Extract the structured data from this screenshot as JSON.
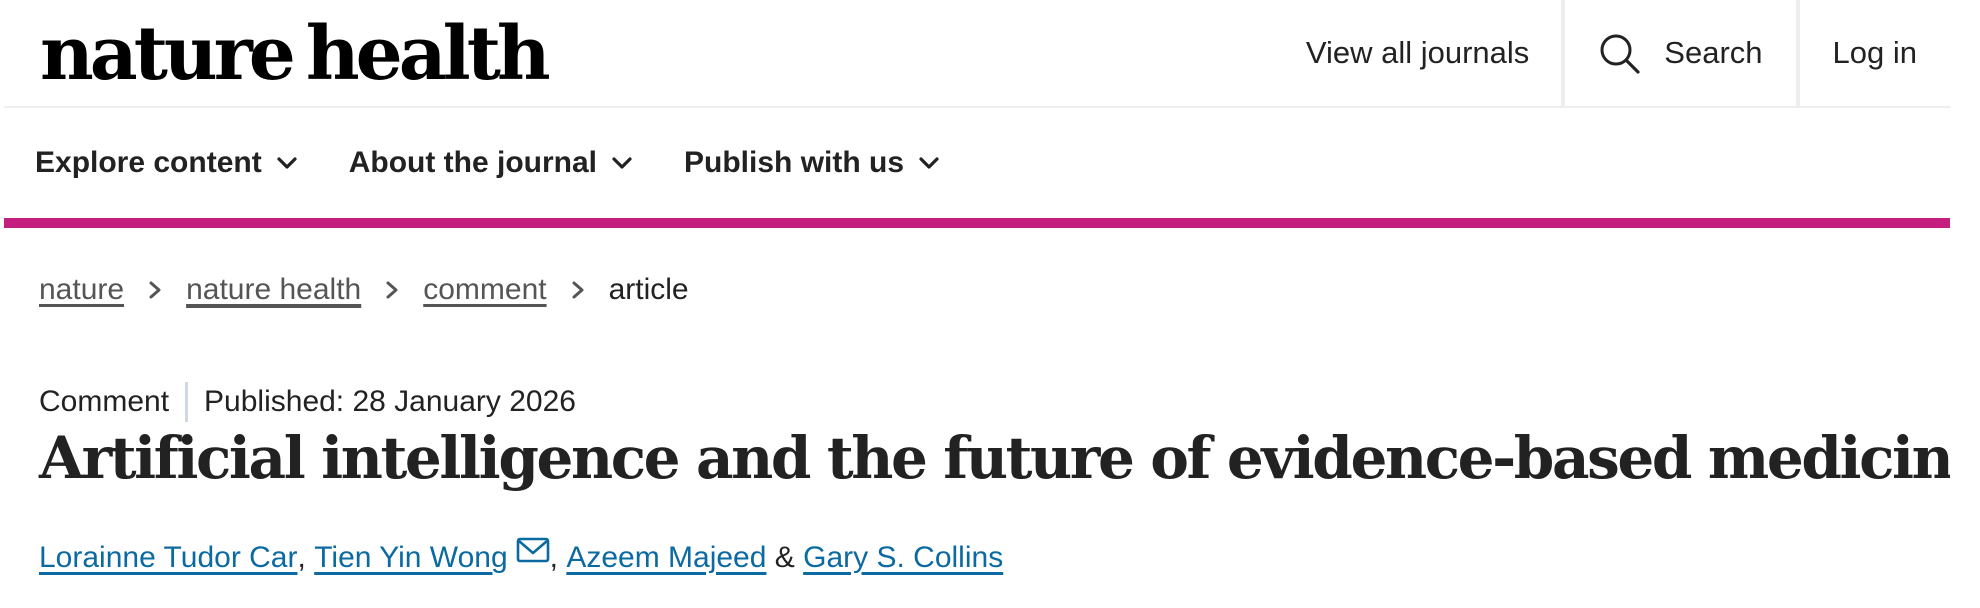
{
  "header": {
    "logo_word1": "nature",
    "logo_word2": "health",
    "view_all_journals": "View all journals",
    "search_label": "Search",
    "login_label": "Log in"
  },
  "nav": {
    "items": [
      {
        "label": "Explore content"
      },
      {
        "label": "About the journal"
      },
      {
        "label": "Publish with us"
      }
    ]
  },
  "breadcrumb": {
    "items": [
      "nature",
      "nature health",
      "comment",
      "article"
    ]
  },
  "article": {
    "type": "Comment",
    "published": "Published: 28 January 2026",
    "title": "Artificial intelligence and the future of evidence-based medicine",
    "authors": [
      "Lorainne Tudor Car",
      "Tien Yin Wong",
      "Azeem Majeed",
      "Gary S. Collins"
    ],
    "author_sep": ",",
    "author_and": "&"
  },
  "colors": {
    "accent_bar": "#c41e7e",
    "link_blue": "#0a6aa1",
    "text": "#222222"
  },
  "icons": [
    "search-icon",
    "chevron-down-icon",
    "chevron-right-icon",
    "mail-icon"
  ]
}
